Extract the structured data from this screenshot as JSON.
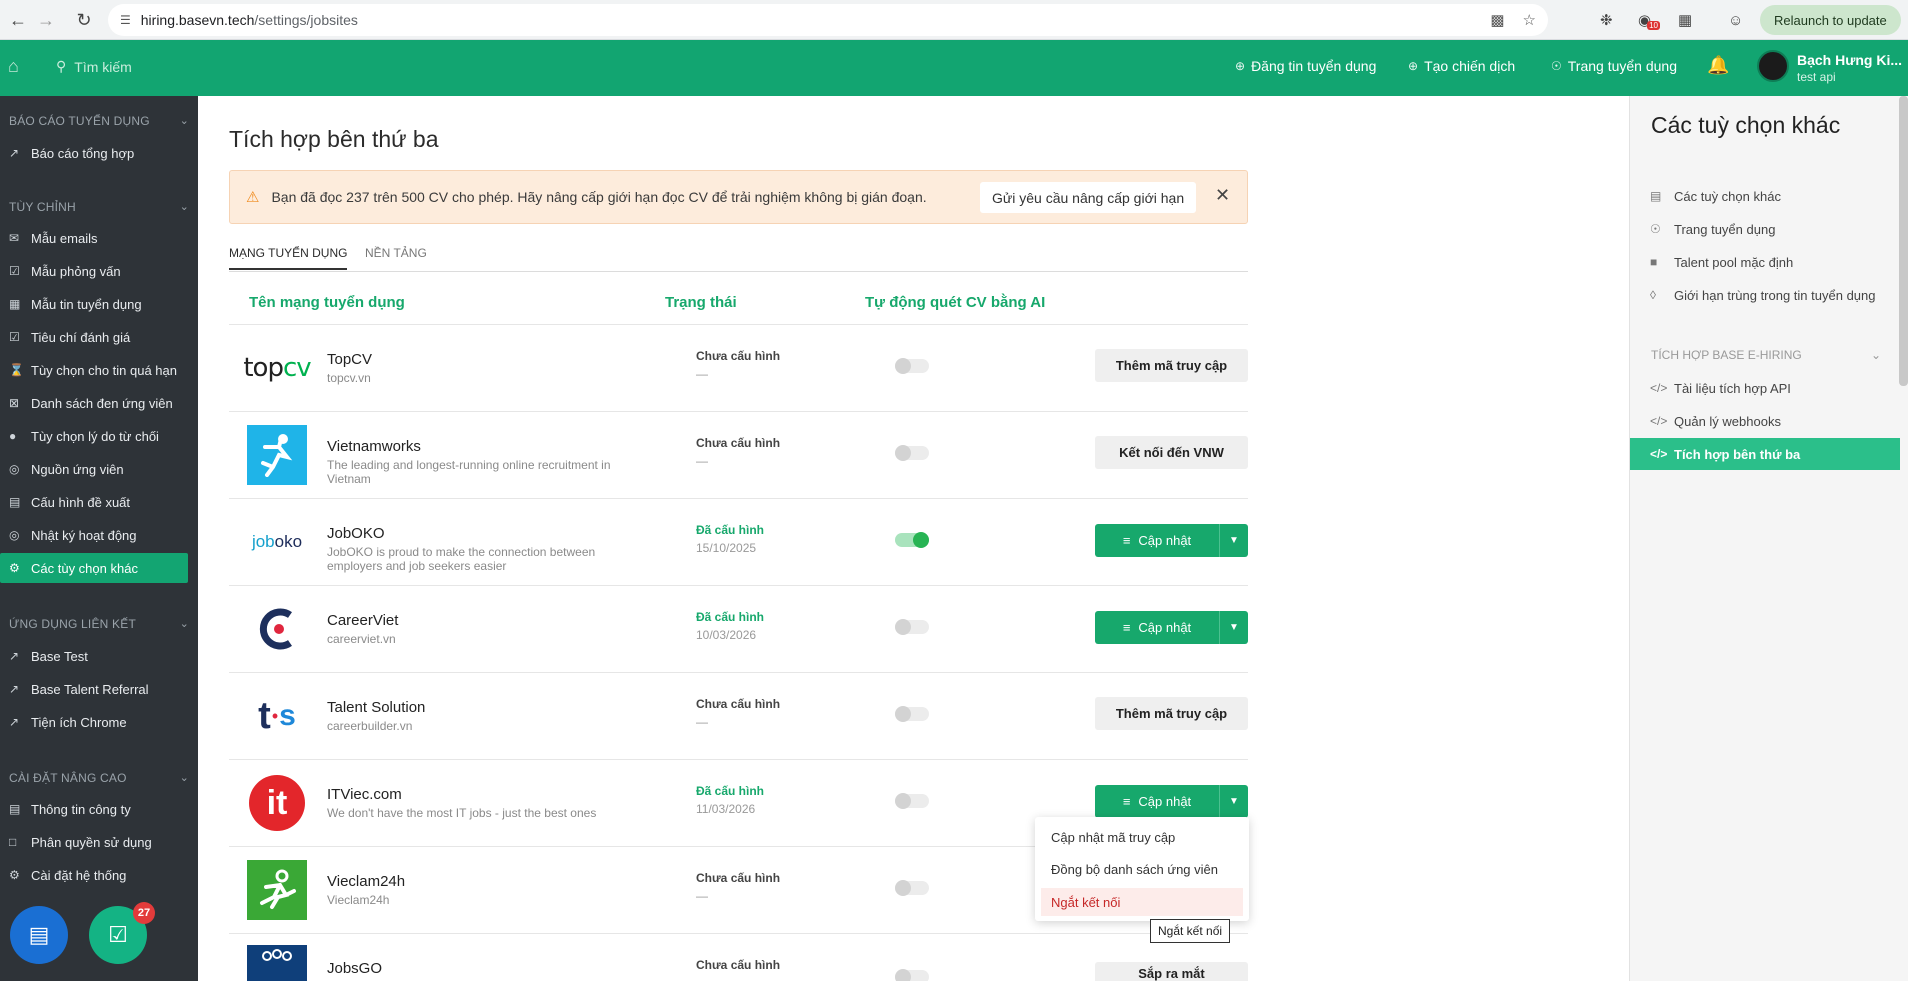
{
  "browser": {
    "url_host": "hiring.basevn.tech",
    "url_path": "/settings/jobsites",
    "relaunch": "Relaunch to update",
    "ext_badge": "10"
  },
  "header": {
    "search_placeholder": "Tìm kiếm",
    "nav": [
      "Đăng tin tuyển dụng",
      "Tạo chiến dịch",
      "Trang tuyển dụng"
    ],
    "user_name": "Bạch Hưng Ki...",
    "user_sub": "test api"
  },
  "sidebar": {
    "sections": [
      {
        "title": "BÁO CÁO TUYỂN DỤNG",
        "items": [
          "Báo cáo tổng hợp"
        ]
      },
      {
        "title": "TÙY CHỈNH",
        "items": [
          "Mẫu emails",
          "Mẫu phỏng vấn",
          "Mẫu tin tuyển dụng",
          "Tiêu chí đánh giá",
          "Tùy chọn cho tin quá hạn",
          "Danh sách đen ứng viên",
          "Tùy chọn lý do từ chối",
          "Nguồn ứng viên",
          "Cấu hình đề xuất",
          "Nhật ký hoạt động",
          "Các tùy chọn khác"
        ]
      },
      {
        "title": "ỨNG DỤNG LIÊN KẾT",
        "items": [
          "Base Test",
          "Base Talent Referral",
          "Tiện ích Chrome"
        ]
      },
      {
        "title": "CÀI ĐẶT NÂNG CAO",
        "items": [
          "Thông tin công ty",
          "Phân quyền sử dụng",
          "Cài đặt hệ thống"
        ]
      }
    ],
    "badge_count": "27"
  },
  "main": {
    "title": "Tích hợp bên thứ ba",
    "alert_text": "Bạn đã đọc 237 trên 500 CV cho phép. Hãy nâng cấp giới hạn đọc CV để trải nghiệm không bị gián đoạn.",
    "alert_button": "Gửi yêu cầu nâng cấp giới hạn",
    "tabs": [
      "MẠNG TUYỂN DỤNG",
      "NỀN TẢNG"
    ],
    "columns": [
      "Tên mạng tuyển dụng",
      "Trạng thái",
      "Tự động quét CV bằng AI"
    ],
    "rows": [
      {
        "name": "TopCV",
        "desc": "topcv.vn",
        "status": "Chưa cấu hình",
        "date": "—",
        "action": "Thêm mã truy cập"
      },
      {
        "name": "Vietnamworks",
        "desc": "The leading and longest-running online recruitment in Vietnam",
        "status": "Chưa cấu hình",
        "date": "—",
        "action": "Kết nối đến VNW"
      },
      {
        "name": "JobOKO",
        "desc": "JobOKO is proud to make the connection between employers and job seekers easier",
        "status": "Đã cấu hình",
        "date": "15/10/2025",
        "action": "Cập nhật"
      },
      {
        "name": "CareerViet",
        "desc": "careerviet.vn",
        "status": "Đã cấu hình",
        "date": "10/03/2026",
        "action": "Cập nhật"
      },
      {
        "name": "Talent Solution",
        "desc": "careerbuilder.vn",
        "status": "Chưa cấu hình",
        "date": "—",
        "action": "Thêm mã truy cập"
      },
      {
        "name": "ITViec.com",
        "desc": "We don't have the most IT jobs - just the best ones",
        "status": "Đã cấu hình",
        "date": "11/03/2026",
        "action": "Cập nhật"
      },
      {
        "name": "Vieclam24h",
        "desc": "Vieclam24h",
        "status": "Chưa cấu hình",
        "date": "—",
        "action": ""
      },
      {
        "name": "JobsGO",
        "desc": "",
        "status": "Chưa cấu hình",
        "date": "",
        "action": "Sắp ra mắt"
      }
    ],
    "logo_text": {
      "topcv_a": "top",
      "topcv_b": "cv",
      "joboko_a": "job",
      "joboko_b": "oko",
      "ts_a": "t",
      "ts_b": "s",
      "it": "it"
    },
    "dropdown": [
      "Cập nhật mã truy cập",
      "Đồng bộ danh sách ứng viên",
      "Ngắt kết nối"
    ],
    "tooltip": "Ngắt kết nối"
  },
  "right": {
    "title": "Các tuỳ chọn khác",
    "items": [
      "Các tuỳ chọn khác",
      "Trang tuyển dụng",
      "Talent pool mặc định",
      "Giới hạn trùng trong tin tuyển dụng"
    ],
    "section": "TÍCH HỢP BASE E-HIRING",
    "section_items": [
      "Tài liệu tích hợp API",
      "Quản lý webhooks",
      "Tích hợp bên thứ ba"
    ]
  },
  "colors": {
    "brand": "#12a571",
    "sidebar": "#2e3338",
    "danger": "#c62828"
  }
}
